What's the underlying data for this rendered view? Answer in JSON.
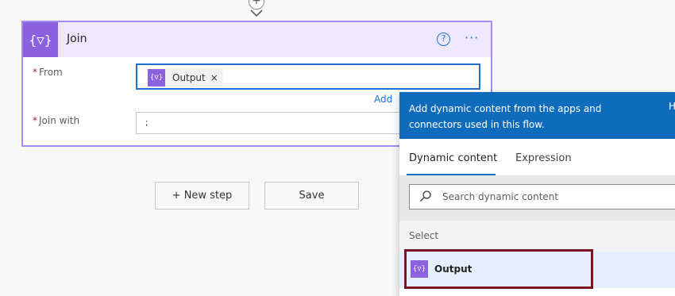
{
  "card": {
    "title": "Join",
    "icon_glyph": "{▽}",
    "help_glyph": "?",
    "more_glyph": "···",
    "fields": {
      "from": {
        "required_mark": "*",
        "label": "From"
      },
      "join_with": {
        "required_mark": "*",
        "label": "Join with",
        "value": ";"
      }
    },
    "token": {
      "label": "Output",
      "icon_glyph": "{▽}",
      "remove_glyph": "×"
    },
    "add_link": "Add"
  },
  "actions": {
    "new_step": "+ New step",
    "save": "Save"
  },
  "connector": {
    "plus_glyph": "+"
  },
  "panel": {
    "header_text": "Add dynamic content from the apps and connectors used in this flow.",
    "header_extra": "H",
    "tabs": [
      "Dynamic content",
      "Expression"
    ],
    "search_placeholder": "Search dynamic content",
    "section_label": "Select",
    "output": {
      "label": "Output",
      "icon_glyph": "{▽}"
    }
  },
  "colors": {
    "accent": "#8c61e0",
    "card_border": "#a78bfa",
    "link": "#1f6fd1",
    "panel_header": "#0f6cbd",
    "highlight_border": "#7a1420"
  }
}
